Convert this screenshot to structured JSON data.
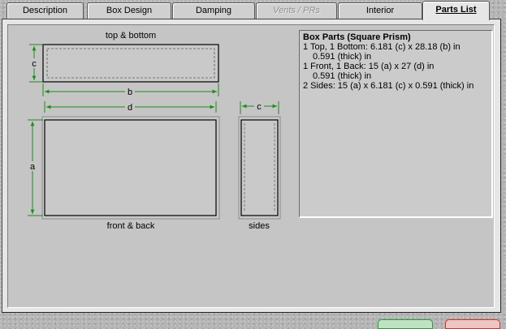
{
  "tabs": [
    {
      "id": "description",
      "label": "Description",
      "state": "normal"
    },
    {
      "id": "box-design",
      "label": "Box Design",
      "state": "normal"
    },
    {
      "id": "damping",
      "label": "Damping",
      "state": "normal"
    },
    {
      "id": "vents-prs",
      "label": "Vents / PRs",
      "state": "disabled"
    },
    {
      "id": "interior",
      "label": "Interior",
      "state": "normal"
    },
    {
      "id": "parts-list",
      "label": "Parts List",
      "state": "active"
    }
  ],
  "diagram": {
    "top_bottom_label": "top & bottom",
    "front_back_label": "front & back",
    "sides_label": "sides",
    "dim_c": "c",
    "dim_b": "b",
    "dim_d": "d",
    "dim_a": "a",
    "dim_color": "#1d8c1d"
  },
  "parts": {
    "title": "Box Parts (Square Prism)",
    "lines": [
      {
        "text": "1 Top, 1 Bottom:  6.181 (c) x 28.18 (b) in",
        "cont": "0.591 (thick) in"
      },
      {
        "text": "1 Front, 1 Back:  15 (a) x 27 (d) in",
        "cont": "0.591 (thick) in"
      },
      {
        "text": "2 Sides:  15 (a) x 6.181 (c) x 0.591 (thick) in",
        "cont": ""
      }
    ]
  },
  "bottom_buttons": {
    "ok_color": "#2e9a3a",
    "cancel_color": "#c0392b"
  }
}
